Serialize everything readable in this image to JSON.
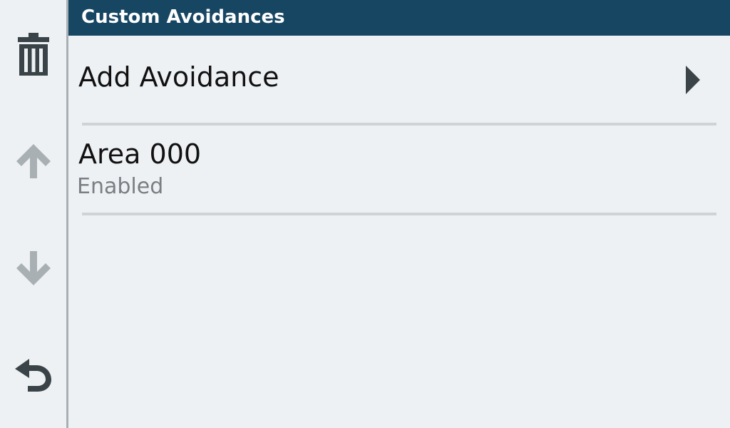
{
  "header": {
    "title": "Custom Avoidances"
  },
  "toolbar": {
    "items": [
      {
        "name": "delete",
        "icon": "trash-icon"
      },
      {
        "name": "move-up",
        "icon": "arrow-up-icon"
      },
      {
        "name": "move-down",
        "icon": "arrow-down-icon"
      },
      {
        "name": "back",
        "icon": "back-arrow-icon"
      }
    ]
  },
  "list": {
    "add": {
      "label": "Add Avoidance",
      "icon": "chevron-right-icon"
    },
    "items": [
      {
        "title": "Area 000",
        "status": "Enabled"
      }
    ]
  },
  "colors": {
    "header_bg": "#174663",
    "page_bg": "#eef1f4",
    "icon_dark": "#3a4448",
    "icon_disabled": "#a9b0b4"
  }
}
